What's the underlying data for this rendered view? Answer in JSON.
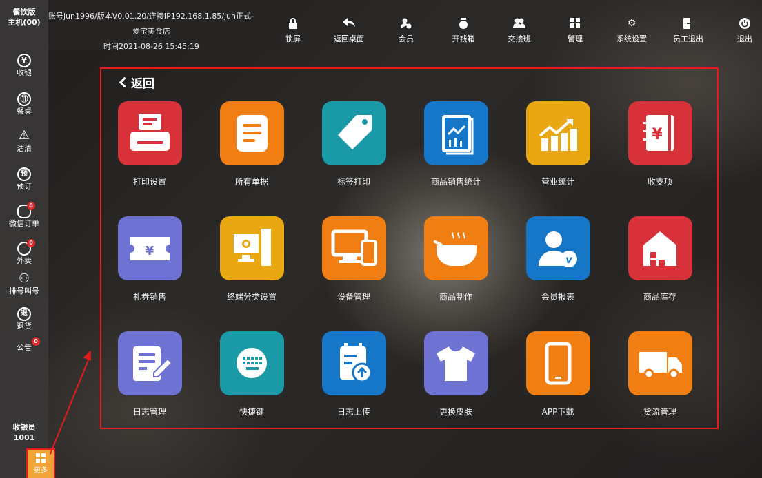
{
  "sidebar": {
    "header": [
      "餐饮版",
      "主机(00)"
    ],
    "items": [
      {
        "glyph": "¥",
        "label": "收银",
        "badge": ""
      },
      {
        "glyph": "⑪",
        "label": "餐桌",
        "badge": ""
      },
      {
        "glyph": "△",
        "label": "沽清",
        "badge": ""
      },
      {
        "glyph": "预",
        "label": "预订",
        "badge": ""
      },
      {
        "glyph": "◔",
        "label": "微信订单",
        "badge": "0"
      },
      {
        "glyph": "◔",
        "label": "外卖",
        "badge": "0"
      },
      {
        "glyph": "⚇",
        "label": "排号叫号",
        "badge": ""
      },
      {
        "glyph": "退",
        "label": "退货",
        "badge": ""
      },
      {
        "glyph": "",
        "label": "公告",
        "badge": "0"
      }
    ],
    "cashier_label": "收银员",
    "cashier_id": "1001",
    "more_label": "更多"
  },
  "top_info": {
    "line1": "账号jun1996/版本V0.01.20/连接IP192.168.1.85/jun正式-",
    "line2": "爱宝美食店",
    "line3": "时间2021-08-26 15:45:19"
  },
  "toolbar": [
    {
      "icon": "lock-icon",
      "glyph": "🔒",
      "label": "锁屏"
    },
    {
      "icon": "return-icon",
      "glyph": "↶",
      "label": "返回桌面"
    },
    {
      "icon": "member-icon",
      "glyph": "👤",
      "label": "会员"
    },
    {
      "icon": "cash-drawer-icon",
      "glyph": "💰",
      "label": "开钱箱"
    },
    {
      "icon": "handover-icon",
      "glyph": "👥",
      "label": "交接班"
    },
    {
      "icon": "manage-icon",
      "glyph": "▦",
      "label": "管理"
    },
    {
      "icon": "gear-icon",
      "glyph": "⚙",
      "label": "系统设置"
    },
    {
      "icon": "staff-exit-icon",
      "glyph": "⇥",
      "label": "员工退出"
    },
    {
      "icon": "power-icon",
      "glyph": "⏻",
      "label": "退出"
    }
  ],
  "panel": {
    "back_label": "返回",
    "tiles": [
      {
        "label": "打印设置",
        "color": "#d9313a",
        "icon": "printer-icon"
      },
      {
        "label": "所有单据",
        "color": "#f07e13",
        "icon": "document-icon"
      },
      {
        "label": "标签打印",
        "color": "#1a9aa6",
        "icon": "tag-icon"
      },
      {
        "label": "商品销售统计",
        "color": "#1677c9",
        "icon": "sales-chart-icon"
      },
      {
        "label": "营业统计",
        "color": "#e9a712",
        "icon": "trend-chart-icon"
      },
      {
        "label": "收支项",
        "color": "#d9313a",
        "icon": "ledger-icon"
      },
      {
        "label": "礼券销售",
        "color": "#6e72d2",
        "icon": "voucher-icon"
      },
      {
        "label": "终端分类设置",
        "color": "#e9a712",
        "icon": "terminal-icon"
      },
      {
        "label": "设备管理",
        "color": "#f07e13",
        "icon": "device-icon"
      },
      {
        "label": "商品制作",
        "color": "#f07e13",
        "icon": "cooking-pot-icon"
      },
      {
        "label": "会员报表",
        "color": "#1677c9",
        "icon": "member-report-icon"
      },
      {
        "label": "商品库存",
        "color": "#d9313a",
        "icon": "warehouse-icon"
      },
      {
        "label": "日志管理",
        "color": "#6e72d2",
        "icon": "edit-log-icon"
      },
      {
        "label": "快捷键",
        "color": "#1a9aa6",
        "icon": "keyboard-icon"
      },
      {
        "label": "日志上传",
        "color": "#1677c9",
        "icon": "upload-log-icon"
      },
      {
        "label": "更换皮肤",
        "color": "#6e72d2",
        "icon": "tshirt-icon"
      },
      {
        "label": "APP下载",
        "color": "#f07e13",
        "icon": "phone-icon"
      },
      {
        "label": "货流管理",
        "color": "#f07e13",
        "icon": "truck-icon"
      }
    ]
  }
}
